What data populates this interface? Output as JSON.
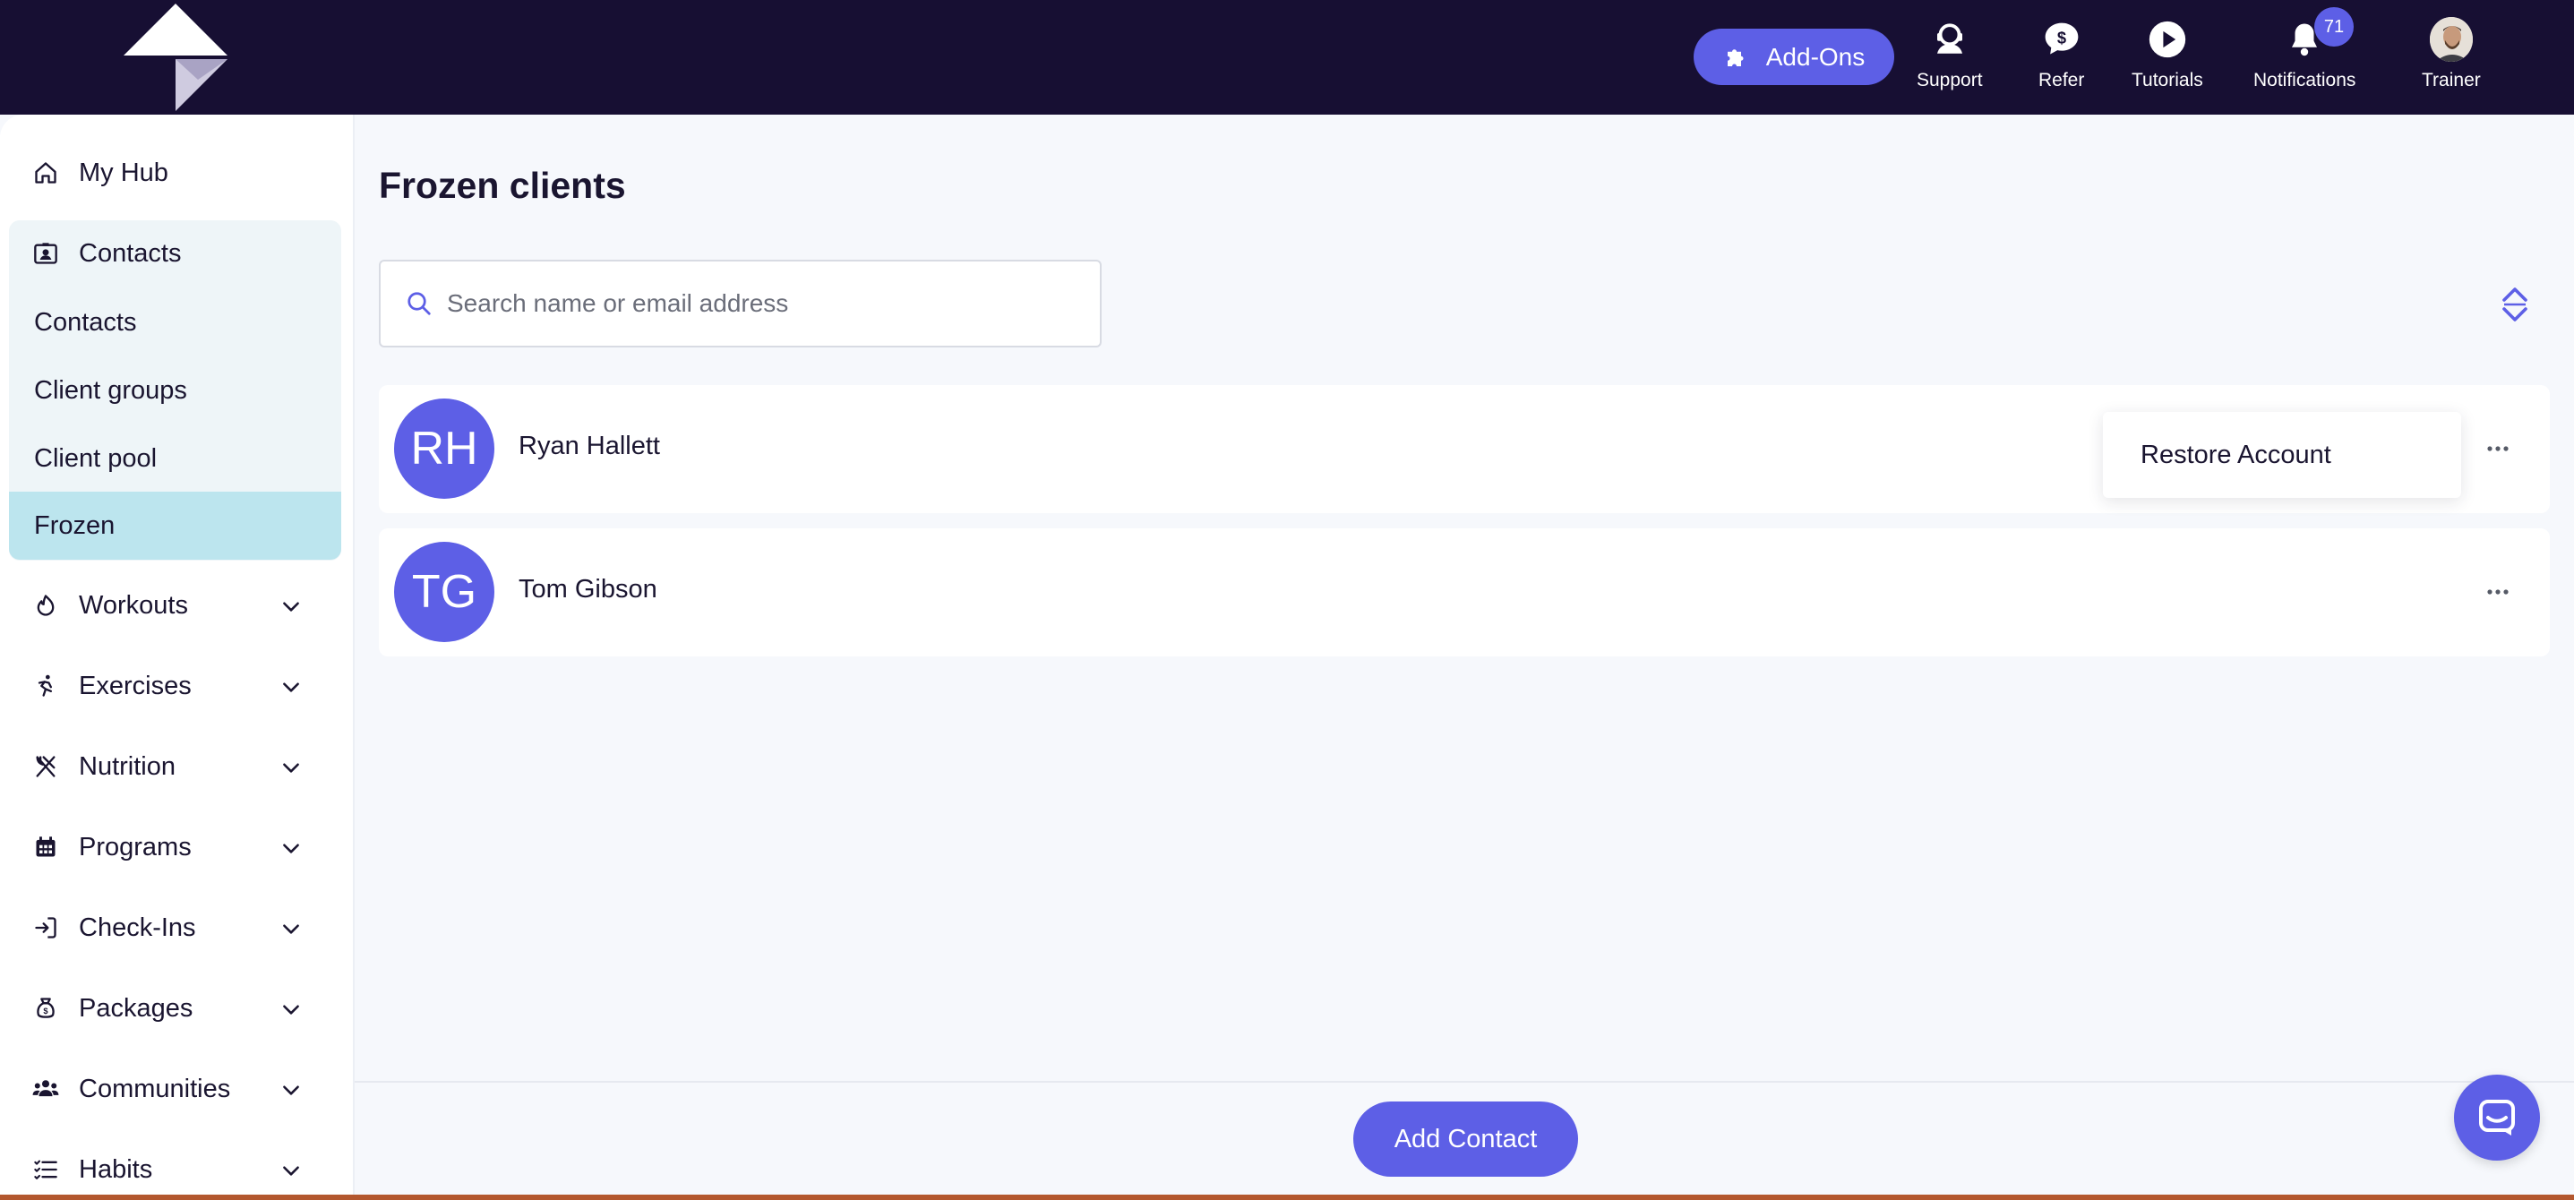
{
  "header": {
    "addons_label": "Add-Ons",
    "nav": [
      {
        "label": "Support",
        "icon": "support-icon"
      },
      {
        "label": "Refer",
        "icon": "refer-dollar-icon"
      },
      {
        "label": "Tutorials",
        "icon": "play-icon"
      },
      {
        "label": "Notifications",
        "icon": "bell-icon",
        "badge": "71"
      },
      {
        "label": "Trainer",
        "icon": "avatar"
      }
    ]
  },
  "sidebar": {
    "my_hub": "My Hub",
    "contacts_header": "Contacts",
    "contacts_sub": [
      "Contacts",
      "Client groups",
      "Client pool",
      "Frozen"
    ],
    "active_sub": "Frozen",
    "sections": [
      {
        "label": "Workouts",
        "icon": "workouts-icon"
      },
      {
        "label": "Exercises",
        "icon": "exercises-icon"
      },
      {
        "label": "Nutrition",
        "icon": "nutrition-icon"
      },
      {
        "label": "Programs",
        "icon": "calendar-icon"
      },
      {
        "label": "Check-Ins",
        "icon": "check-in-icon"
      },
      {
        "label": "Packages",
        "icon": "packages-icon"
      },
      {
        "label": "Communities",
        "icon": "communities-icon"
      },
      {
        "label": "Habits",
        "icon": "habits-icon"
      }
    ]
  },
  "main": {
    "title": "Frozen clients",
    "search_placeholder": "Search name or email address",
    "clients": [
      {
        "initials": "RH",
        "name": "Ryan Hallett"
      },
      {
        "initials": "TG",
        "name": "Tom Gibson"
      }
    ],
    "context_menu": {
      "item": "Restore Account"
    },
    "add_contact_label": "Add Contact"
  },
  "colors": {
    "accent": "#5d5fe6",
    "topbar": "#170f33",
    "active_sub": "#bce5ee"
  }
}
